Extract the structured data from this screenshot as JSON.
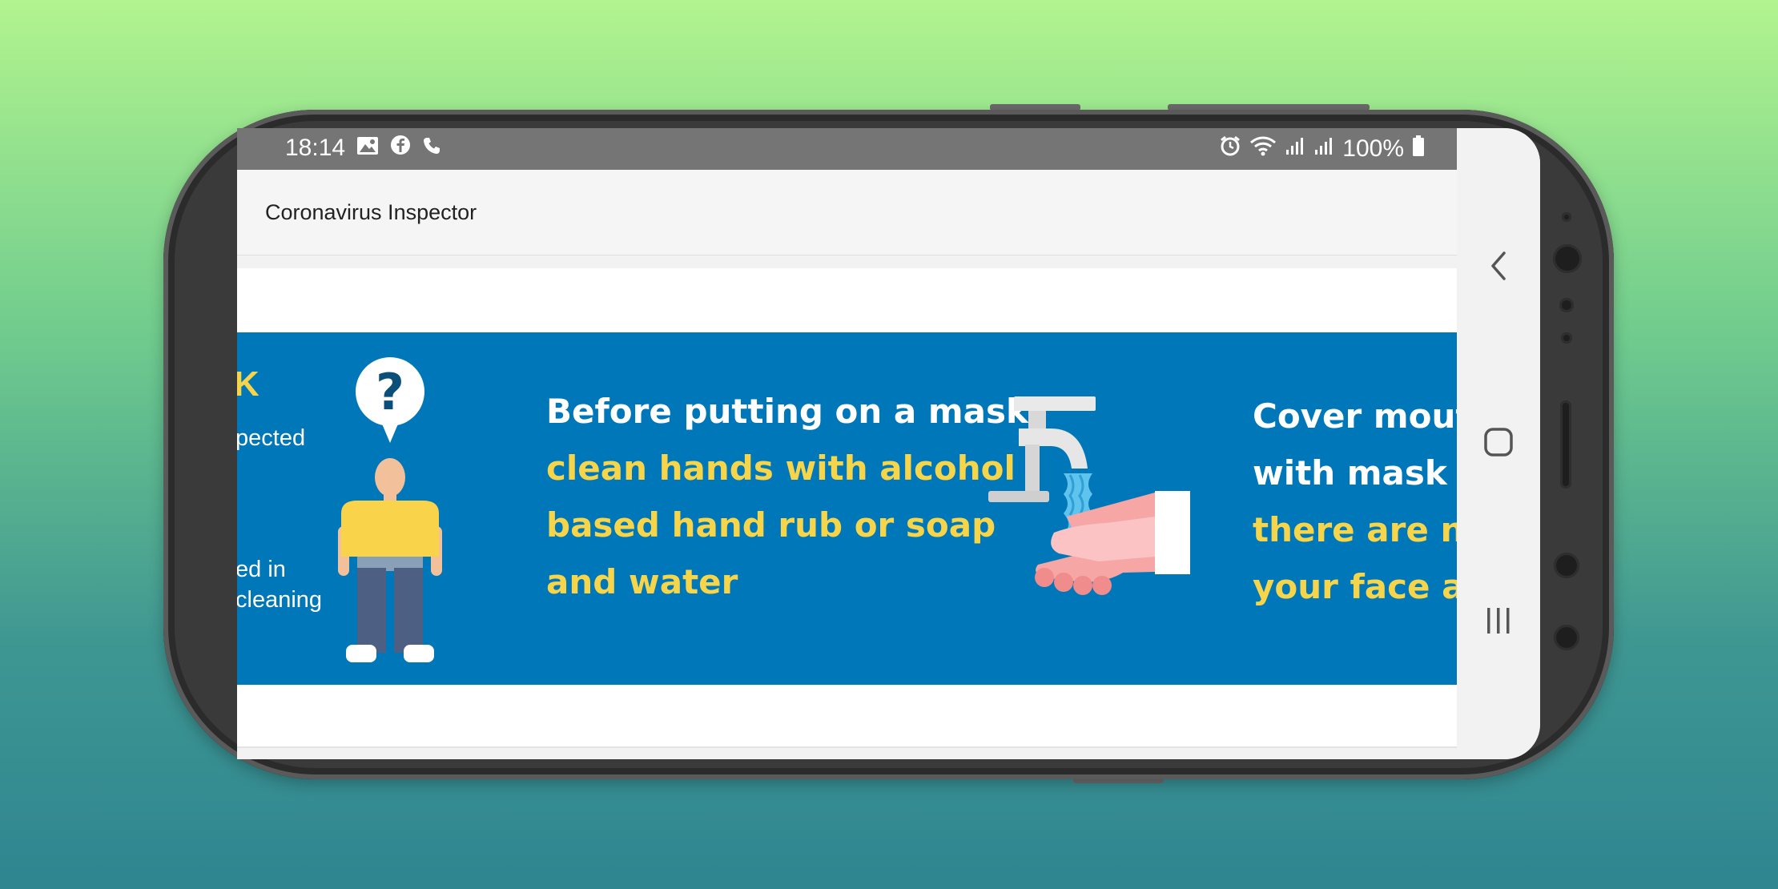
{
  "status_bar": {
    "time": "18:14",
    "left_icons": [
      "image-icon",
      "facebook-icon",
      "phone-icon"
    ],
    "right_icons": [
      "alarm-icon",
      "wifi-icon",
      "signal-icon",
      "signal-icon",
      "battery-icon"
    ],
    "battery": "100%"
  },
  "app_bar": {
    "title": "Coronavirus Inspector"
  },
  "banner": {
    "partial_left": {
      "heading": "K",
      "line1": "pected",
      "line2": "ed in",
      "line3": "cleaning"
    },
    "panel_mask": {
      "line1": "Before putting on a mask,",
      "line2": "clean hands with alcohol",
      "line3": "based hand rub or soap",
      "line4": "and water"
    },
    "panel_cover": {
      "line1": "Cover mouth",
      "line2": "with mask a",
      "line3": "there are no",
      "line4": "your face an"
    },
    "colors": {
      "background": "#0077b8",
      "highlight": "#f7d54a",
      "text": "#ffffff"
    }
  },
  "nav_bar": {
    "buttons": [
      "back-icon",
      "home-icon",
      "recents-icon"
    ]
  },
  "colors": {
    "status_bar": "#757575",
    "app_bar": "#f5f5f5"
  }
}
